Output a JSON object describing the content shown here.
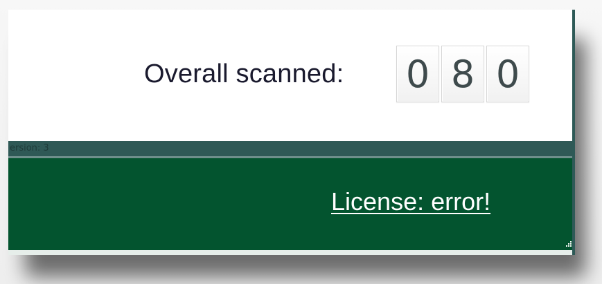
{
  "scan": {
    "label": "Overall scanned:",
    "digits": [
      "0",
      "8",
      "0"
    ]
  },
  "divider": {
    "text": "ersion: 3"
  },
  "license": {
    "link_text": "License: error!"
  },
  "colors": {
    "top_background": "#ffffff",
    "divider_band": "#2f5956",
    "bottom_background": "#03542f",
    "link_text": "#ffffff"
  },
  "icons": {
    "resize_grip": "resize-grip-icon"
  }
}
